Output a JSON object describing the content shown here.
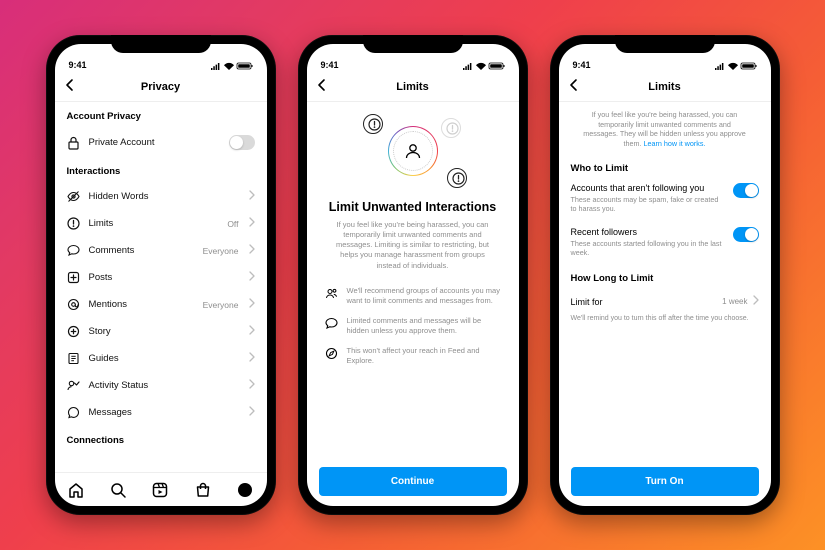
{
  "statusbar": {
    "time": "9:41"
  },
  "colors": {
    "accent": "#0095f6"
  },
  "phone1": {
    "title": "Privacy",
    "sections": {
      "account_privacy": {
        "header": "Account Privacy",
        "private_account": {
          "label": "Private Account",
          "enabled": false
        }
      },
      "interactions": {
        "header": "Interactions",
        "items": [
          {
            "icon": "eye-off-icon",
            "label": "Hidden Words",
            "value": ""
          },
          {
            "icon": "alert-circle-icon",
            "label": "Limits",
            "value": "Off"
          },
          {
            "icon": "comment-icon",
            "label": "Comments",
            "value": "Everyone"
          },
          {
            "icon": "plus-square-icon",
            "label": "Posts",
            "value": ""
          },
          {
            "icon": "at-icon",
            "label": "Mentions",
            "value": "Everyone"
          },
          {
            "icon": "story-icon",
            "label": "Story",
            "value": ""
          },
          {
            "icon": "guides-icon",
            "label": "Guides",
            "value": ""
          },
          {
            "icon": "activity-icon",
            "label": "Activity Status",
            "value": ""
          },
          {
            "icon": "messages-icon",
            "label": "Messages",
            "value": ""
          }
        ]
      },
      "connections": {
        "header": "Connections"
      }
    },
    "tabs": [
      "home-icon",
      "search-icon",
      "reels-icon",
      "shop-icon",
      "profile-icon"
    ]
  },
  "phone2": {
    "title": "Limits",
    "headline": "Limit Unwanted Interactions",
    "body": "If you feel like you're being harassed, you can temporarily limit unwanted comments and messages. Limiting is similar to restricting, but helps you manage harassment from groups instead of individuals.",
    "bullets": [
      {
        "icon": "group-icon",
        "text": "We'll recommend groups of accounts you may want to limit comments and messages from."
      },
      {
        "icon": "speech-icon",
        "text": "Limited comments and messages will be hidden unless you approve them."
      },
      {
        "icon": "compass-icon",
        "text": "This won't affect your reach in Feed and Explore."
      }
    ],
    "cta": "Continue"
  },
  "phone3": {
    "title": "Limits",
    "intro": "If you feel like you're being harassed, you can temporarily limit unwanted comments and messages. They will be hidden unless you approve them.",
    "intro_link": "Learn how it works.",
    "who_header": "Who to Limit",
    "options": [
      {
        "title": "Accounts that aren't following you",
        "sub": "These accounts may be spam, fake or created to harass you.",
        "enabled": true
      },
      {
        "title": "Recent followers",
        "sub": "These accounts started following you in the last week.",
        "enabled": true
      }
    ],
    "duration_header": "How Long to Limit",
    "duration": {
      "label": "Limit for",
      "value": "1 week"
    },
    "duration_hint": "We'll remind you to turn this off after the time you choose.",
    "cta": "Turn On"
  }
}
